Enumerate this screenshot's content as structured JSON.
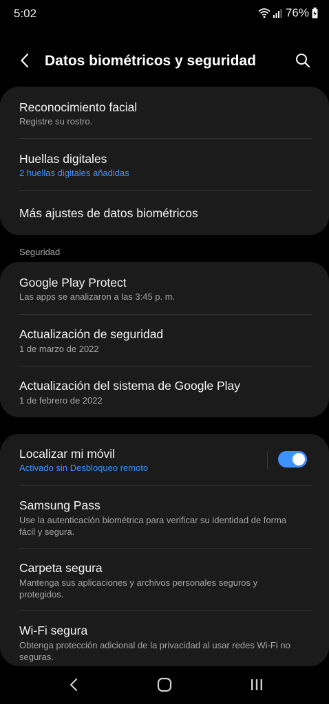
{
  "status_bar": {
    "time": "5:02",
    "battery": "76%",
    "icons": [
      "wifi-icon",
      "signal-icon",
      "battery-icon"
    ]
  },
  "header": {
    "title": "Datos biométricos y seguridad",
    "back_icon": "back-arrow-icon",
    "search_icon": "search-icon"
  },
  "biometrics": {
    "items": [
      {
        "title": "Reconocimiento facial",
        "subtitle": "Registre su rostro."
      },
      {
        "title": "Huellas digitales",
        "subtitle": "2 huellas digitales añadidas"
      },
      {
        "title": "Más ajustes de datos biométricos"
      }
    ]
  },
  "security": {
    "label": "Seguridad",
    "items": [
      {
        "title": "Google Play Protect",
        "subtitle": "Las apps se analizaron a las 3:45 p. m."
      },
      {
        "title": "Actualización de seguridad",
        "subtitle": "1 de marzo de 2022"
      },
      {
        "title": "Actualización del sistema de Google Play",
        "subtitle": "1 de febrero de 2022"
      }
    ]
  },
  "other": {
    "items": [
      {
        "title": "Localizar mi móvil",
        "subtitle": "Activado sin Desbloqueo remoto",
        "toggle": true
      },
      {
        "title": "Samsung Pass",
        "subtitle": "Use la autenticación biométrica para verificar su identidad de forma fácil y segura."
      },
      {
        "title": "Carpeta segura",
        "subtitle": "Mantenga sus aplicaciones y archivos personales seguros y protegidos."
      },
      {
        "title": "Wi-Fi segura",
        "subtitle": "Obtenga protección adicional de la privacidad al usar redes Wi-Fi no seguras."
      }
    ]
  },
  "nav_bar": {
    "icons": [
      "nav-back-icon",
      "home-icon",
      "recents-icon"
    ]
  },
  "colors": {
    "background": "#000000",
    "card": "#1b1b1b",
    "accent": "#3e91ff",
    "toggle_on": "#3e91ff",
    "text_primary": "#f2f2f2",
    "text_secondary": "#a6a6a6"
  }
}
